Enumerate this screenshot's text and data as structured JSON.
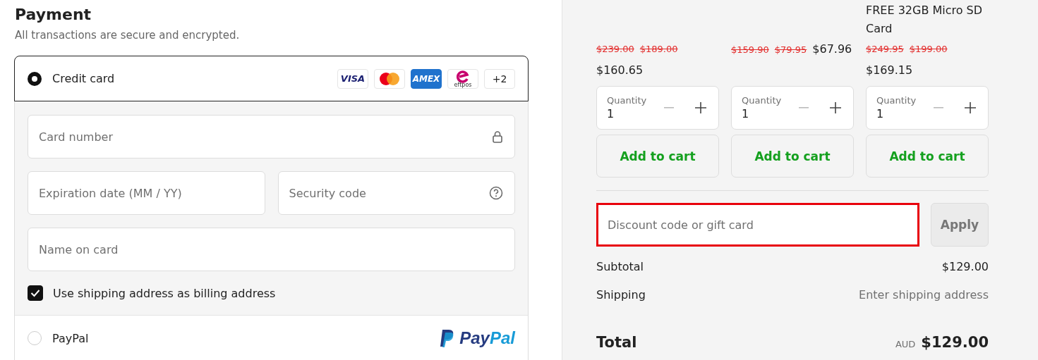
{
  "payment": {
    "title": "Payment",
    "subtitle": "All transactions are secure and encrypted.",
    "methods": [
      {
        "kind": "card",
        "label": "Credit card",
        "selected": true,
        "badges": [
          {
            "kind": "visa",
            "text": "VISA"
          },
          {
            "kind": "mastercard"
          },
          {
            "kind": "amex",
            "text": "AMEX"
          },
          {
            "kind": "eftpos",
            "text": "eftpos"
          },
          {
            "kind": "more",
            "text": "+2"
          }
        ],
        "fields": [
          {
            "kind": "lock",
            "placeholder": "Card number"
          },
          {
            "kind": "half",
            "placeholder": "Expiration date (MM / YY)"
          },
          {
            "kind": "half-help",
            "placeholder": "Security code"
          },
          {
            "kind": "plain",
            "placeholder": "Name on card"
          }
        ],
        "billing_checkbox": {
          "label": "Use shipping address as billing address",
          "checked": true
        }
      },
      {
        "kind": "paypal",
        "label": "PayPal",
        "selected": false,
        "logo": {
          "first": "Pay",
          "second": "Pal"
        }
      }
    ]
  },
  "products": [
    {
      "old_prices": [
        "$239.00",
        "$189.00"
      ],
      "price": "$160.65",
      "quantity_label": "Quantity",
      "quantity": "1",
      "button": "Add to cart"
    },
    {
      "old_prices": [
        "$159.90",
        "$79.95"
      ],
      "price": "$67.96",
      "quantity_label": "Quantity",
      "quantity": "1",
      "button": "Add to cart"
    },
    {
      "title": "FREE 32GB Micro SD Card",
      "old_prices": [
        "$249.95",
        "$199.00"
      ],
      "price": "$169.15",
      "quantity_label": "Quantity",
      "quantity": "1",
      "button": "Add to cart"
    }
  ],
  "discount": {
    "placeholder": "Discount code or gift card",
    "highlighted": true,
    "button": "Apply",
    "button_disabled": true
  },
  "summary": {
    "rows": [
      {
        "label": "Subtotal",
        "value": "$129.00",
        "muted": false
      },
      {
        "label": "Shipping",
        "value": "Enter shipping address",
        "muted": true
      }
    ],
    "total": {
      "label": "Total",
      "currency": "AUD",
      "value": "$129.00"
    }
  }
}
